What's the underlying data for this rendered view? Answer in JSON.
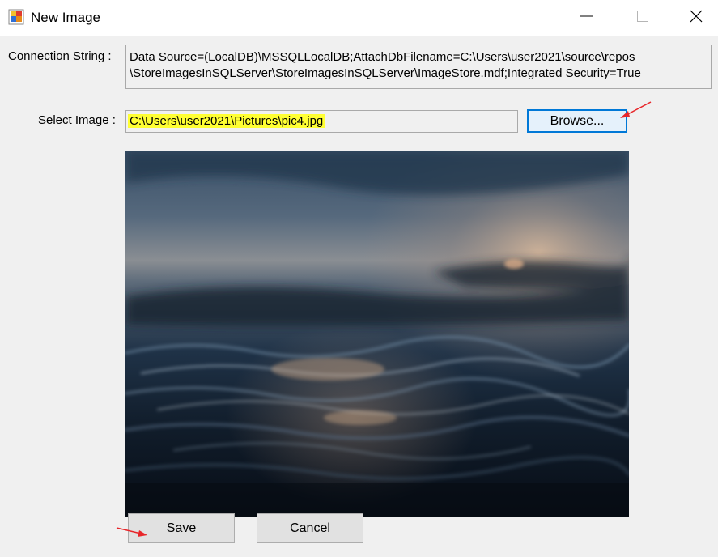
{
  "window": {
    "title": "New Image",
    "controls": [
      "minimize",
      "maximize",
      "close"
    ]
  },
  "connection": {
    "label": "Connection String :",
    "value_lines": [
      "Data Source=(LocalDB)\\MSSQLLocalDB;AttachDbFilename=C:\\Users\\user2021\\source\\repos",
      "\\StoreImagesInSQLServer\\StoreImagesInSQLServer\\ImageStore.mdf;Integrated Security=True"
    ]
  },
  "image_select": {
    "label": "Select Image :",
    "path": "C:\\Users\\user2021\\Pictures\\pic4.jpg",
    "browse_label": "Browse..."
  },
  "preview": {
    "subject": "dark ocean water surface with ripples"
  },
  "actions": {
    "save_label": "Save",
    "cancel_label": "Cancel"
  },
  "colors": {
    "window_bg": "#f0f0f0",
    "titlebar_bg": "#ffffff",
    "highlight": "#ffff33",
    "focus_border": "#0078d7",
    "annotation_arrow": "#e8262a"
  },
  "icons": {
    "app": "app-icon",
    "minimize": "minimize-icon",
    "maximize": "maximize-icon",
    "close": "close-icon",
    "arrows": [
      "arrow-browse-icon",
      "arrow-save-icon"
    ]
  }
}
